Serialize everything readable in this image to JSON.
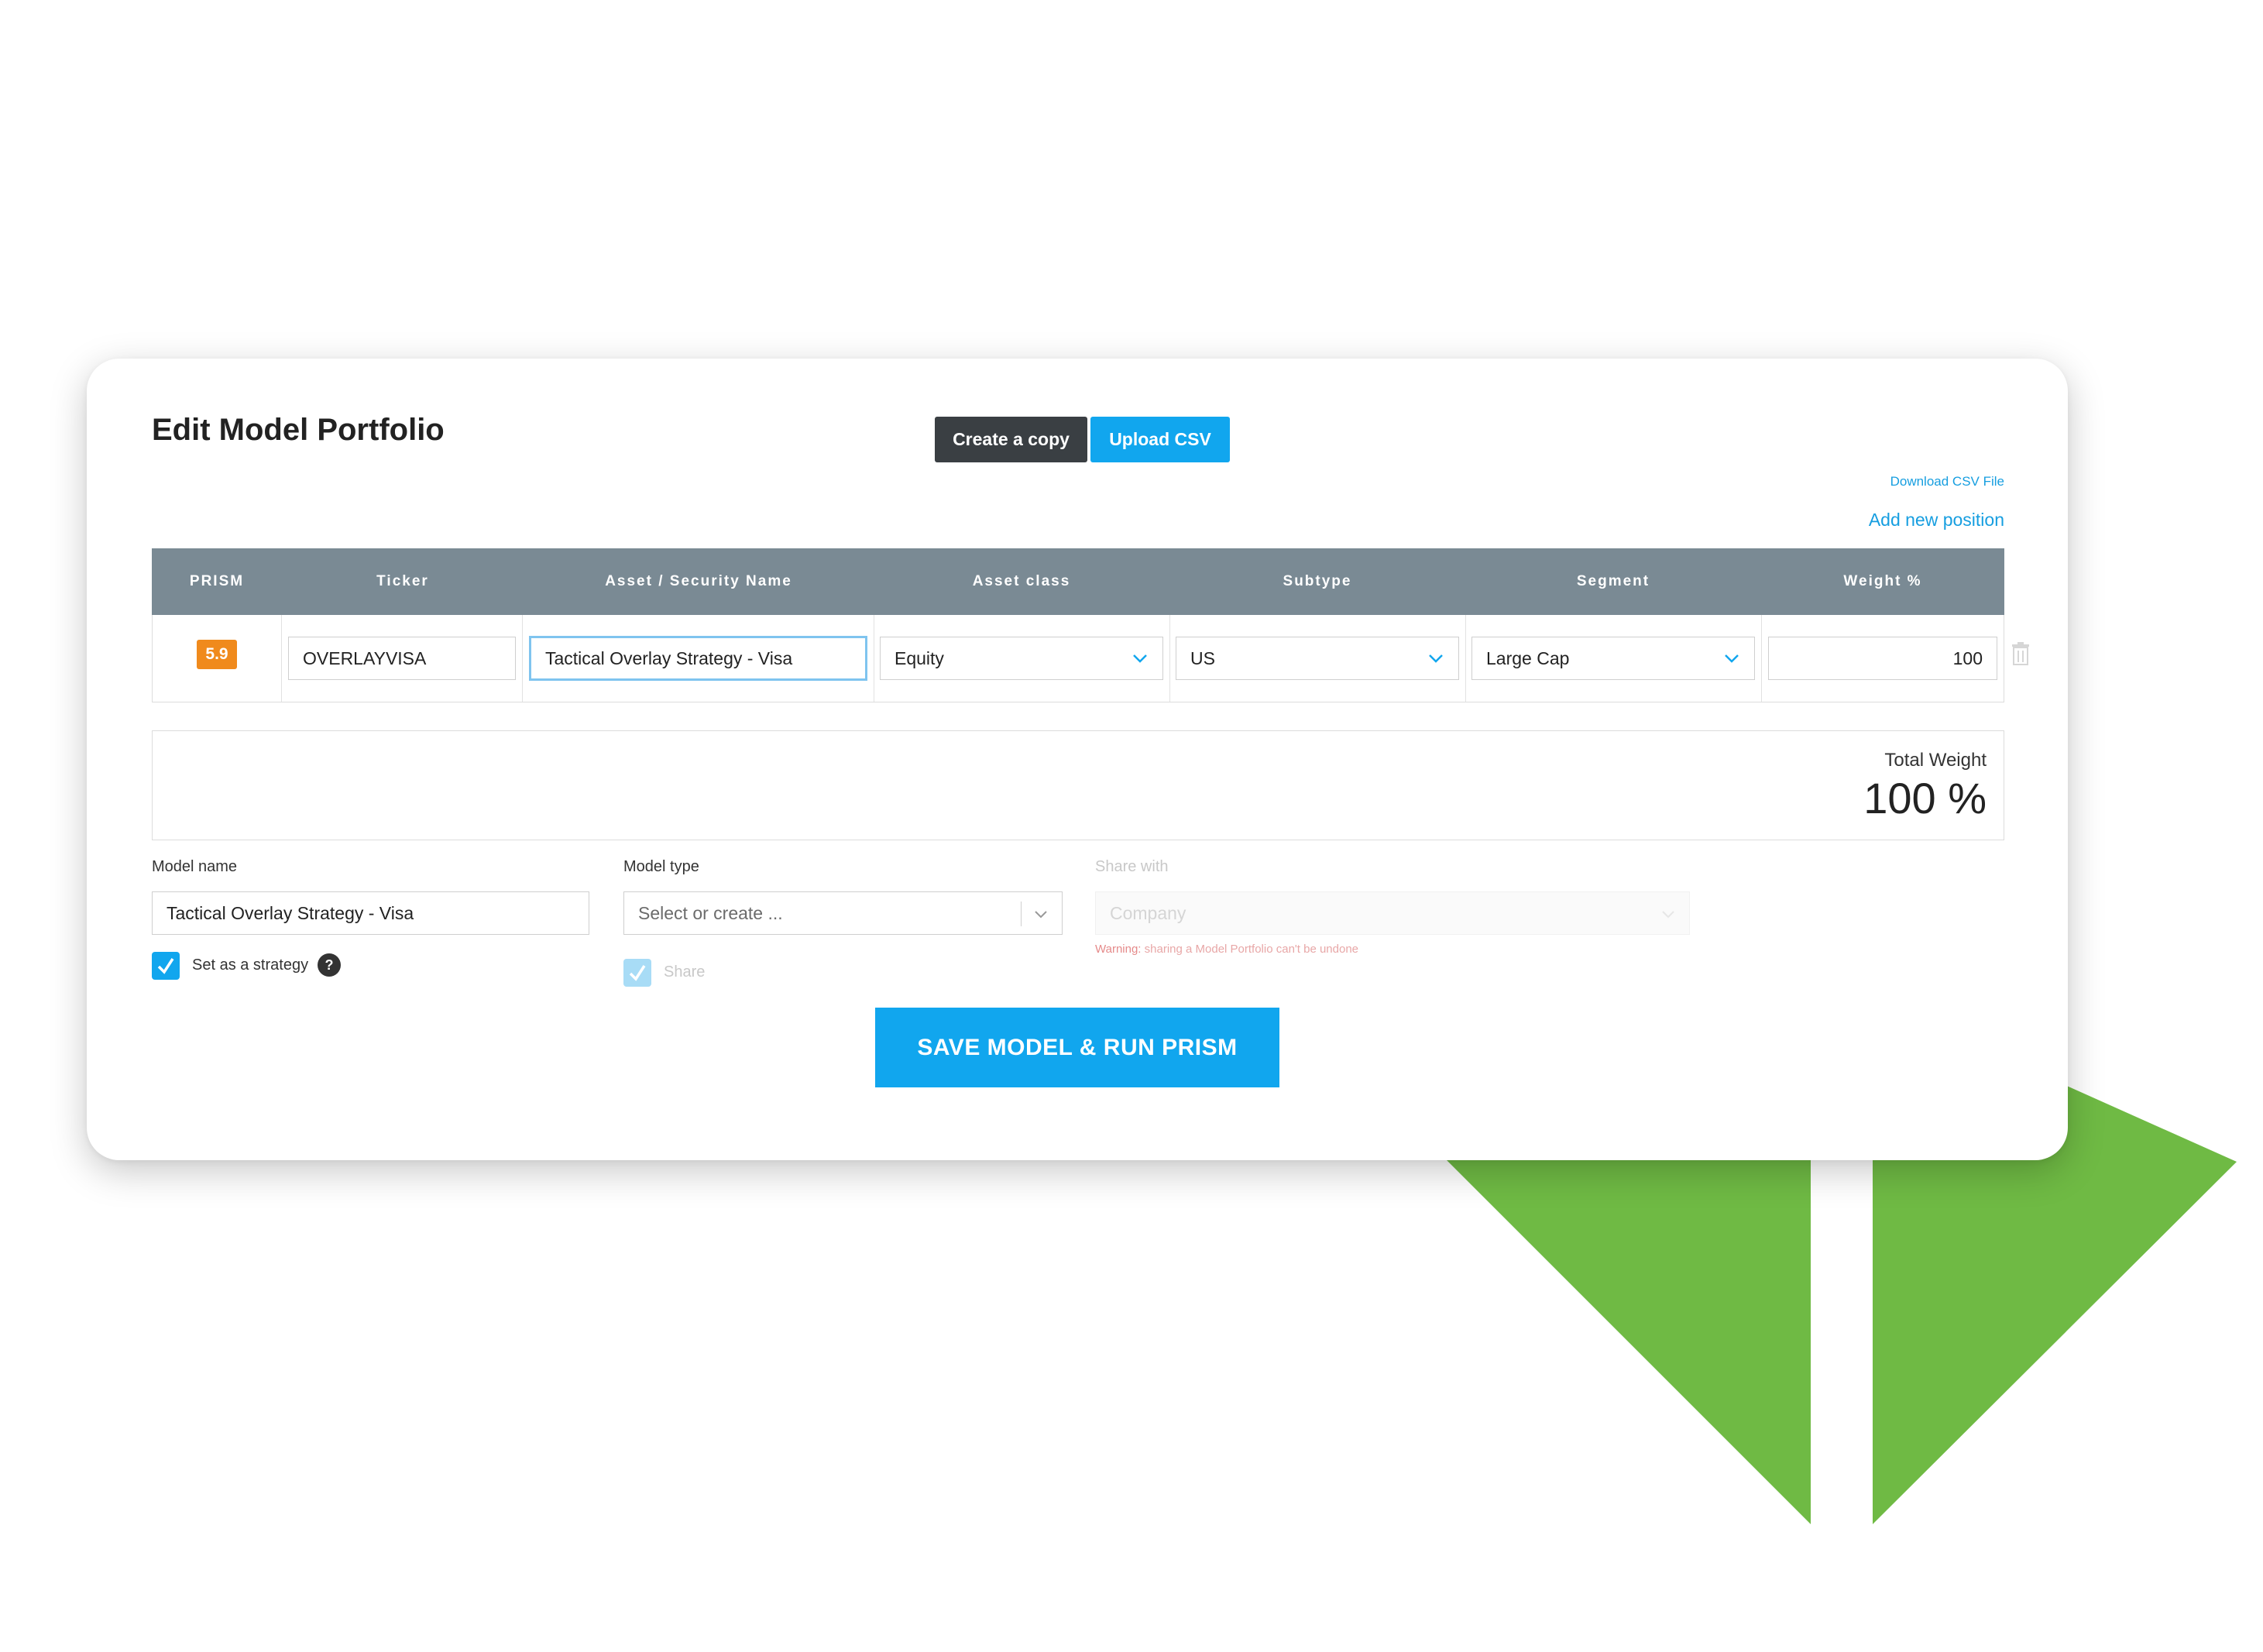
{
  "colors": {
    "accent": "#11a6ee",
    "dark_button": "#3a3f43",
    "table_header": "#7a8a94",
    "prism_badge": "#f08a1c",
    "decor_green": "#6fba44"
  },
  "header": {
    "title": "Edit Model Portfolio",
    "create_copy_label": "Create a copy",
    "upload_csv_label": "Upload CSV",
    "download_csv_label": "Download CSV File",
    "add_position_label": "Add new position"
  },
  "table": {
    "columns": [
      "PRISM",
      "Ticker",
      "Asset / Security Name",
      "Asset class",
      "Subtype",
      "Segment",
      "Weight %"
    ],
    "rows": [
      {
        "prism": "5.9",
        "ticker": "OVERLAYVISA",
        "name": "Tactical Overlay Strategy - Visa",
        "asset_class": "Equity",
        "subtype": "US",
        "segment": "Large Cap",
        "weight": "100",
        "delete_icon": "trash-icon"
      }
    ]
  },
  "total": {
    "label": "Total Weight",
    "value": "100 %"
  },
  "form": {
    "model_name_label": "Model name",
    "model_name_value": "Tactical Overlay Strategy - Visa",
    "strategy_label": "Set as a strategy",
    "strategy_checked": true,
    "help_glyph": "?",
    "model_type_label": "Model type",
    "model_type_placeholder": "Select or create ...",
    "share_label": "Share",
    "share_checked": true,
    "share_with_label": "Share with",
    "share_with_placeholder": "Company",
    "warning_prefix": "Warning:",
    "warning_text": " sharing a Model Portfolio can't be undone"
  },
  "save_label": "SAVE MODEL & RUN PRISM"
}
